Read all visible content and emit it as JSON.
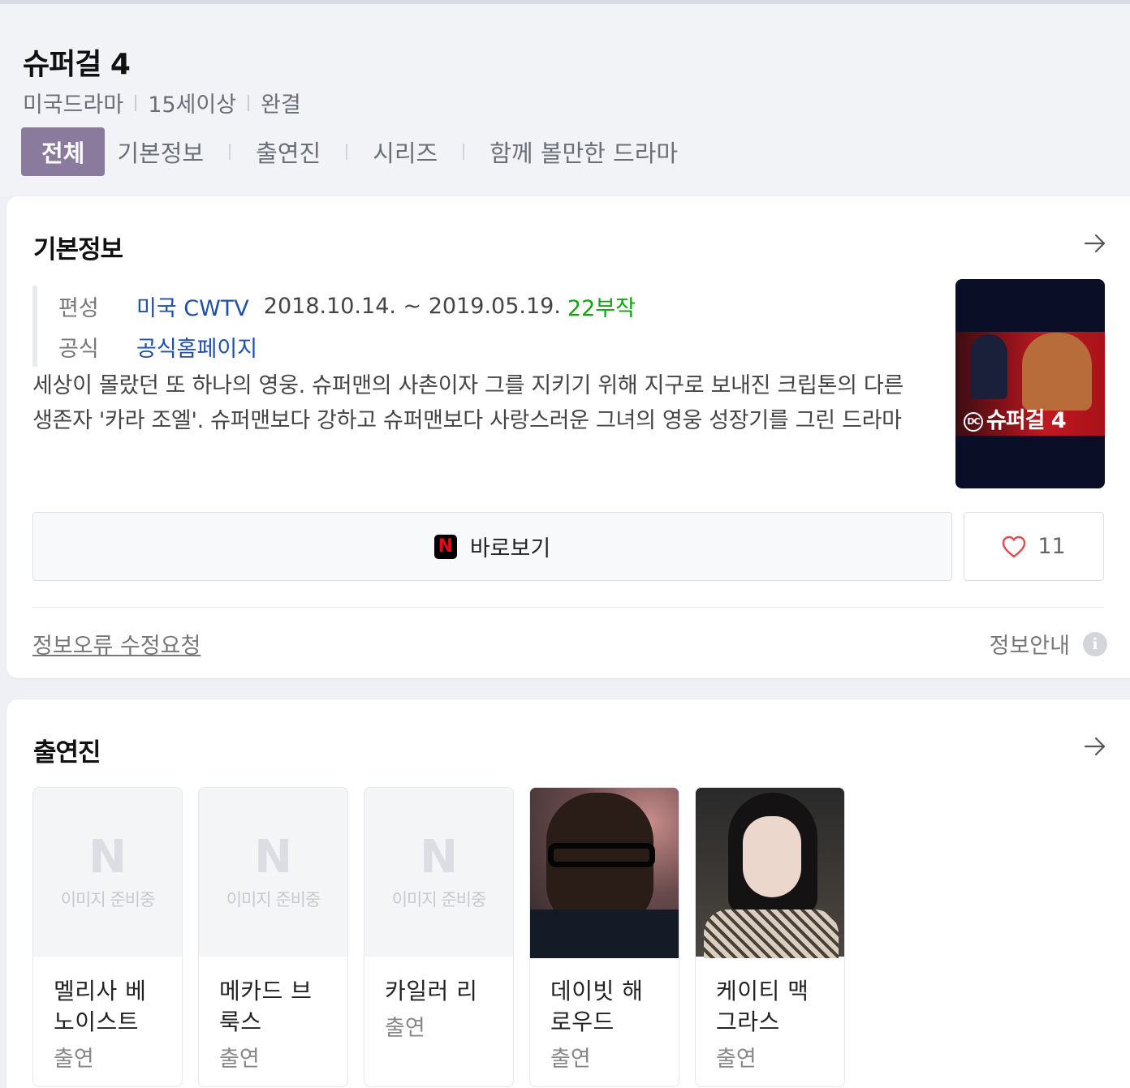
{
  "header": {
    "title": "슈퍼걸 4",
    "meta": [
      "미국드라마",
      "15세이상",
      "완결"
    ]
  },
  "tabs": [
    {
      "label": "전체",
      "active": true
    },
    {
      "label": "기본정보",
      "active": false
    },
    {
      "label": "출연진",
      "active": false
    },
    {
      "label": "시리즈",
      "active": false
    },
    {
      "label": "함께 볼만한 드라마",
      "active": false
    }
  ],
  "basic_info": {
    "title": "기본정보",
    "broadcast": {
      "label": "편성",
      "channel": "미국 CWTV",
      "period": "2018.10.14. ~ 2019.05.19.",
      "episodes": "22부작"
    },
    "official": {
      "label": "공식",
      "link": "공식홈페이지"
    },
    "synopsis": "세상이 몰랐던 또 하나의 영웅. 슈퍼맨의 사촌이자 그를 지키기 위해 지구로 보내진 크립톤의 다른 생존자 '카라 조엘'. 슈퍼맨보다 강하고 슈퍼맨보다 사랑스러운 그녀의 영웅 성장기를 그린 드라마",
    "poster_text": "슈퍼걸 4",
    "poster_logo": "DC",
    "watch_label": "바로보기",
    "netflix_letter": "N",
    "like_count": "11",
    "report_label": "정보오류 수정요청",
    "guide_label": "정보안내",
    "info_icon": "i"
  },
  "cast": {
    "title": "출연진",
    "placeholder_letter": "N",
    "placeholder_text": "이미지 준비중",
    "members": [
      {
        "name": "멜리사 베노이스트",
        "role": "출연",
        "has_photo": false
      },
      {
        "name": "메카드 브룩스",
        "role": "출연",
        "has_photo": false
      },
      {
        "name": "카일러 리",
        "role": "출연",
        "has_photo": false
      },
      {
        "name": "데이빗 해로우드",
        "role": "출연",
        "has_photo": true
      },
      {
        "name": "케이티 맥그라스",
        "role": "출연",
        "has_photo": true
      }
    ]
  },
  "colors": {
    "accent_tab": "#8a7b9e",
    "link": "#1f4fa8",
    "episodes": "#12a312",
    "heart": "#e5484d"
  }
}
